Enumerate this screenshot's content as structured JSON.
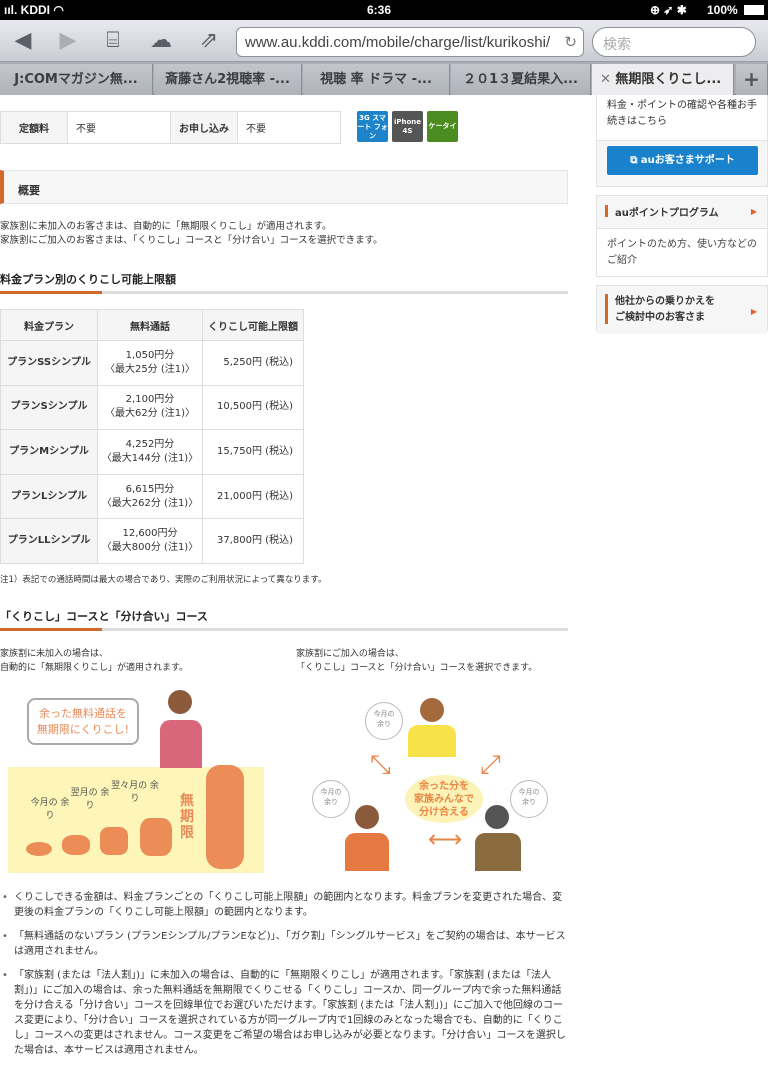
{
  "status": {
    "carrier": "KDDI",
    "time": "6:36",
    "battery": "100%"
  },
  "browser": {
    "url": "www.au.kddi.com/mobile/charge/list/kurikoshi/",
    "search_placeholder": "検索",
    "tabs": [
      {
        "label": "J:COMマガジン無..."
      },
      {
        "label": "斎藤さん2視聴率 -..."
      },
      {
        "label": "視聴 率 ドラマ -..."
      },
      {
        "label": "２０1３夏結果入..."
      },
      {
        "label": "無期限くりこし..."
      }
    ]
  },
  "info": {
    "fee_label": "定額料",
    "fee_value": "不要",
    "apply_label": "お申し込み",
    "apply_value": "不要",
    "badges": [
      {
        "label": "3G スマート フォン",
        "color": "#1d84c9"
      },
      {
        "label": "iPhone 4S",
        "color": "#555"
      },
      {
        "label": "ケータイ",
        "color": "#4a8c1f"
      }
    ]
  },
  "overview": {
    "title": "概要",
    "lines": [
      "家族割に未加入のお客さまは、自動的に「無期限くりこし」が適用されます。",
      "家族割にご加入のお客さまは、「くりこし」コースと「分け合い」コースを選択できます。"
    ]
  },
  "plans": {
    "title": "料金プラン別のくりこし可能上限額",
    "headers": [
      "料金プラン",
      "無料通話",
      "くりこし可能上限額"
    ],
    "rows": [
      {
        "plan": "プランSSシンプル",
        "free": "1,050円分",
        "max": "〈最大25分 (注1)〉",
        "limit": "5,250円 (税込)"
      },
      {
        "plan": "プランSシンプル",
        "free": "2,100円分",
        "max": "〈最大62分 (注1)〉",
        "limit": "10,500円 (税込)"
      },
      {
        "plan": "プランMシンプル",
        "free": "4,252円分",
        "max": "〈最大144分 (注1)〉",
        "limit": "15,750円 (税込)"
      },
      {
        "plan": "プランLシンプル",
        "free": "6,615円分",
        "max": "〈最大262分 (注1)〉",
        "limit": "21,000円 (税込)"
      },
      {
        "plan": "プランLLシンプル",
        "free": "12,600円分",
        "max": "〈最大800分 (注1)〉",
        "limit": "37,800円 (税込)"
      }
    ],
    "note": "注1）表記での通話時間は最大の場合であり、実際のご利用状況によって異なります。"
  },
  "courses": {
    "title": "「くりこし」コースと「分け合い」コース",
    "left": {
      "line1": "家族割に未加入の場合は、",
      "line2": "自動的に「無期限くりこし」が適用されます。",
      "bubble1": "余った無料通話を",
      "bubble2": "無期限にくりこし!",
      "m1": "今月の 余り",
      "m2": "翌月の 余り",
      "m3": "翌々月の 余り",
      "unlimited": "無期限"
    },
    "right": {
      "line1": "家族割にご加入の場合は、",
      "line2": "「くりこし」コースと「分け合い」コースを選択できます。",
      "center1": "余った分を",
      "center2": "家族みんなで",
      "center3": "分け合える",
      "rem": "今月の 余り"
    }
  },
  "bullets": [
    "くりこしできる金額は、料金プランごとの「くりこし可能上限額」の範囲内となります。料金プランを変更された場合、変更後の料金プランの「くりこし可能上限額」の範囲内となります。",
    "「無料通話のないプラン (プランEシンプル/プランEなど)」、「ガク割」「シングルサービス」をご契約の場合は、本サービスは適用されません。",
    "「家族割 (または「法人割」)」に未加入の場合は、自動的に「無期限くりこし」が適用されます。「家族割 (または「法人割」)」にご加入の場合は、余った無料通話を無期限でくりこせる「くりこし」コースか、同一グループ内で余った無料通話を分け合える「分け合い」コースを回線単位でお選びいただけます。「家族割 (または「法人割」)」にご加入で他回線のコース変更により、「分け合い」コースを選択されている方が同一グループ内で1回線のみとなった場合でも、自動的に「くりこし」コースへの変更はされません。コース変更をご希望の場合はお申し込みが必要となります。「分け合い」コースを選択した場合は、本サービスは適用されません。"
  ],
  "sidebar": {
    "support_text": "料金・ポイントの確認や各種お手続きはこちら",
    "support_button": "auお客さまサポート",
    "points_title": "auポイントプログラム",
    "points_text": "ポイントのため方、使い方などのご紹介",
    "switch_title1": "他社からの乗りかえを",
    "switch_title2": "ご検討中のお客さま"
  }
}
